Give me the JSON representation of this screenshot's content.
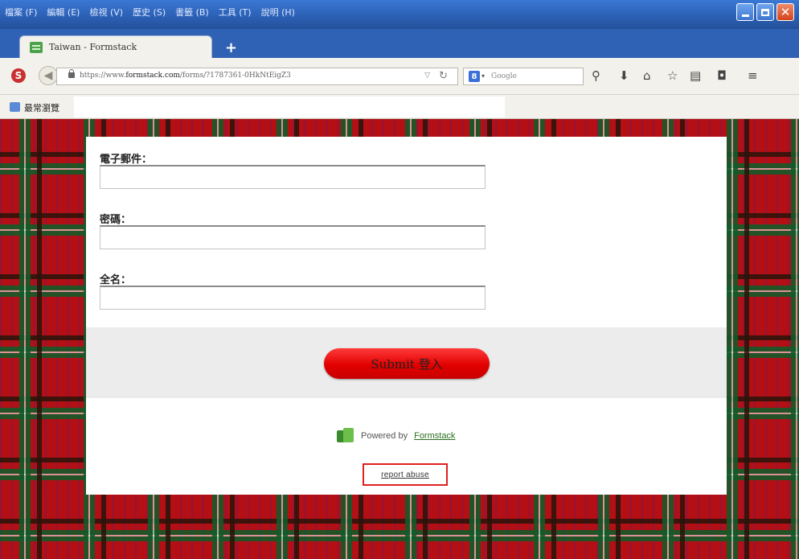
{
  "browser": {
    "menu_items": [
      "檔案 (F)",
      "編輯 (E)",
      "檢視 (V)",
      "歷史 (S)",
      "書籤 (B)",
      "工具 (T)",
      "說明 (H)"
    ],
    "tab_title": "Taiwan - Formstack",
    "new_tab": "+",
    "url_prefix": "https://www.",
    "url_domain": "formstack.com",
    "url_path": "/forms/?1787361-0HkNtEigZ3",
    "search_engine_placeholder": "Google",
    "bookmarks_label": "最常瀏覽"
  },
  "form": {
    "email_label": "電子郵件：",
    "email_value": "",
    "password_label": "密碼：",
    "password_value": "",
    "fullname_label": "全名：",
    "fullname_value": "",
    "submit_label": "Submit 登入",
    "powered_text": "Powered by",
    "powered_link": "Formstack",
    "report_abuse": "report abuse"
  },
  "colors": {
    "submit": "#e20000",
    "highlight_box": "#e02020",
    "plaid_red": "#b30f14",
    "plaid_green": "#145a28"
  },
  "icons": [
    "stylish-icon",
    "back-arrow-icon",
    "lock-icon",
    "reload-icon",
    "google-icon",
    "search-icon",
    "download-icon",
    "home-icon",
    "star-icon",
    "library-icon",
    "pocket-icon",
    "menu-icon",
    "formstack-logo-icon",
    "bookmark-folder-icon"
  ]
}
